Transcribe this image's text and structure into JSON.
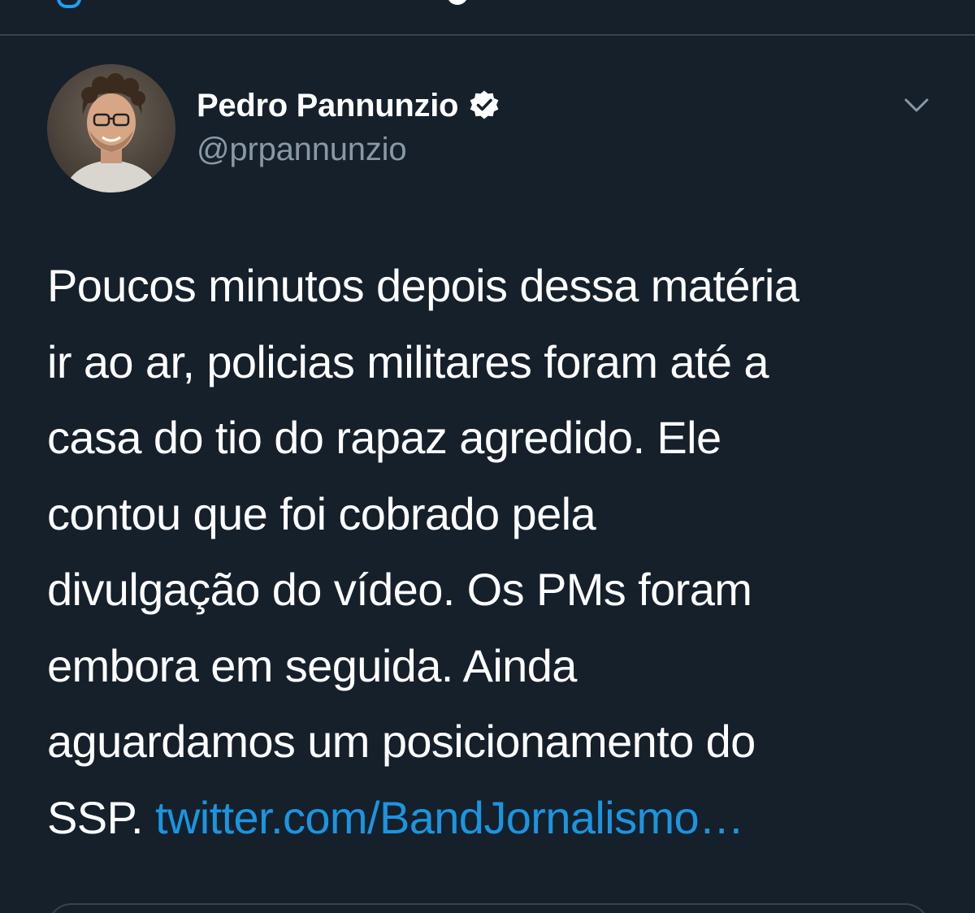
{
  "tweet": {
    "author": {
      "display_name": "Pedro Pannunzio",
      "handle": "@prpannunzio",
      "verified": true,
      "avatar_icon": "user-avatar-photo"
    },
    "text": "Poucos minutos depois dessa matéria\nir ao ar, policias militares foram até a\ncasa do tio do rapaz agredido. Ele\ncontou que foi cobrado pela\ndivulgação do vídeo. Os PMs foram\nembora em seguida. Ainda\naguardamos um posicionamento do\nSSP. ",
    "link_text": "twitter.com/BandJornalismo…",
    "menu_icon": "chevron-down-icon"
  },
  "colors": {
    "background": "#15202b",
    "text_primary": "#ffffff",
    "text_secondary": "#8899a6",
    "link": "#1b95e0",
    "divider": "#38444d",
    "verified_badge": "#ffffff"
  }
}
